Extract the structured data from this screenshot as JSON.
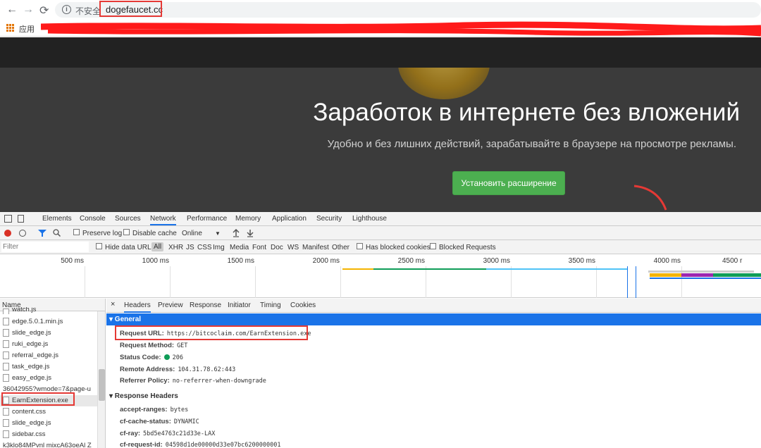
{
  "browser": {
    "nav_back": "←",
    "nav_forward": "→",
    "nav_reload": "⟳",
    "insecure_label": "不安全",
    "url": "dogefaucet.cc",
    "apps_label": "应用"
  },
  "site": {
    "title": "Заработок в интернете без вложений",
    "subtitle": "Удобно и без лишних действий, зарабатывайте в браузере на просмотре рекламы.",
    "install_button": "Установить расширение"
  },
  "devtools": {
    "tabs": [
      "Elements",
      "Console",
      "Sources",
      "Network",
      "Performance",
      "Memory",
      "Application",
      "Security",
      "Lighthouse"
    ],
    "active_tab": "Network",
    "toolbar": {
      "preserve_log": "Preserve log",
      "disable_cache": "Disable cache",
      "throttle": "Online",
      "throttle_arrow": "▼"
    },
    "filter": {
      "placeholder": "Filter",
      "hide_data_urls": "Hide data URLs",
      "types": [
        "All",
        "XHR",
        "JS",
        "CSS",
        "Img",
        "Media",
        "Font",
        "Doc",
        "WS",
        "Manifest",
        "Other"
      ],
      "has_blocked_cookies": "Has blocked cookies",
      "blocked_requests": "Blocked Requests"
    },
    "timeline_ticks": [
      "500 ms",
      "1000 ms",
      "1500 ms",
      "2000 ms",
      "2500 ms",
      "3000 ms",
      "3500 ms",
      "4000 ms",
      "4500 r"
    ],
    "request_list": {
      "header": "Name",
      "items": [
        "watch.js",
        "edge.5.0.1.min.js",
        "slide_edge.js",
        "ruki_edge.js",
        "referral_edge.js",
        "task_edge.js",
        "easy_edge.js",
        "36042955?wmode=7&page-u",
        "EarnExtension.exe",
        "content.css",
        "slide_edge.js",
        "sidebar.css",
        "k3klo84MPvnl mixcA63oeAl Z"
      ]
    },
    "detail_tabs": [
      "Headers",
      "Preview",
      "Response",
      "Initiator",
      "Timing",
      "Cookies"
    ],
    "detail_close": "×",
    "general": {
      "title": "▾ General",
      "rows": [
        {
          "key": "Request URL:",
          "value": "https://bitcoclaim.com/EarnExtension.exe"
        },
        {
          "key": "Request Method:",
          "value": "GET"
        },
        {
          "key": "Status Code:",
          "value": "206"
        },
        {
          "key": "Remote Address:",
          "value": "104.31.78.62:443"
        },
        {
          "key": "Referrer Policy:",
          "value": "no-referrer-when-downgrade"
        }
      ]
    },
    "response_headers": {
      "title": "▾ Response Headers",
      "rows": [
        {
          "key": "accept-ranges:",
          "value": "bytes"
        },
        {
          "key": "cf-cache-status:",
          "value": "DYNAMIC"
        },
        {
          "key": "cf-ray:",
          "value": "5bd5e4763c21d33e-LAX"
        },
        {
          "key": "cf-request-id:",
          "value": "04598d1de00000d33e07bc6200000001"
        }
      ]
    }
  },
  "colors": {
    "accent": "#1a73e8",
    "annotation_red": "#e53935",
    "install_green": "#4caf50"
  }
}
